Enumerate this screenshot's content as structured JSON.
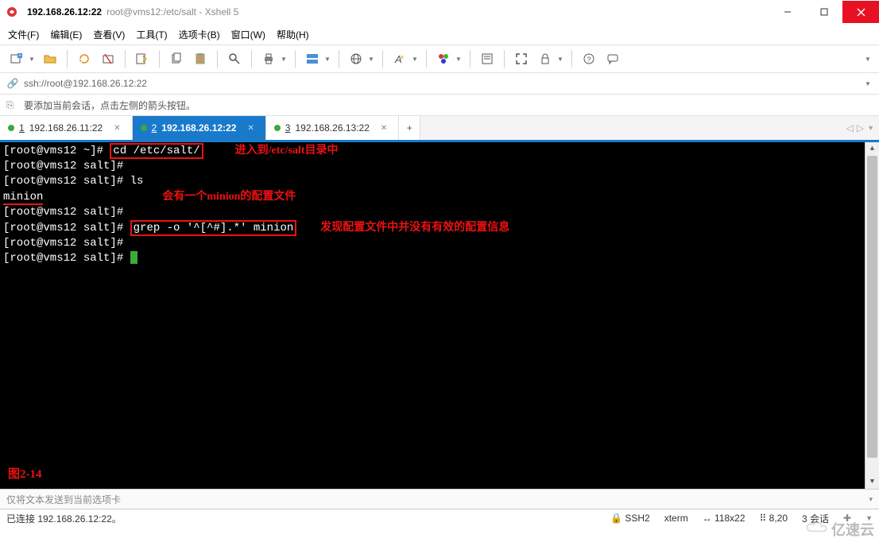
{
  "title": {
    "active": "192.168.26.12:22",
    "sub": "root@vms12:/etc/salt - Xshell 5"
  },
  "menu": {
    "file": "文件(F)",
    "edit": "编辑(E)",
    "view": "查看(V)",
    "tools": "工具(T)",
    "tabs": "选项卡(B)",
    "window": "窗口(W)",
    "help": "帮助(H)"
  },
  "address": "ssh://root@192.168.26.12:22",
  "hint": "要添加当前会话，点击左侧的箭头按钮。",
  "tabs": [
    {
      "num": "1",
      "label": "192.168.26.11:22",
      "active": false
    },
    {
      "num": "2",
      "label": "192.168.26.12:22",
      "active": true
    },
    {
      "num": "3",
      "label": "192.168.26.13:22",
      "active": false
    }
  ],
  "terminal": {
    "l1_prompt": "[root@vms12 ~]# ",
    "l1_cmd": "cd /etc/salt/",
    "l1_ann": "进入到/etc/salt目录中",
    "l2": "[root@vms12 salt]#",
    "l3": "[root@vms12 salt]# ls",
    "l4": "minion",
    "l4_ann": "会有一个minion的配置文件",
    "l5": "[root@vms12 salt]#",
    "l6_prompt": "[root@vms12 salt]# ",
    "l6_cmd": "grep -o '^[^#].*' minion",
    "l6_ann": "发现配置文件中并没有有效的配置信息",
    "l7": "[root@vms12 salt]#",
    "l8": "[root@vms12 salt]# ",
    "fig": "图2-14"
  },
  "sendbar": {
    "placeholder": "仅将文本发送到当前选项卡"
  },
  "status": {
    "conn": "已连接 192.168.26.12:22。",
    "ssh": "SSH2",
    "term": "xterm",
    "size": "118x22",
    "pos": "8,20",
    "sess": "3 会话"
  },
  "watermark": "亿速云"
}
